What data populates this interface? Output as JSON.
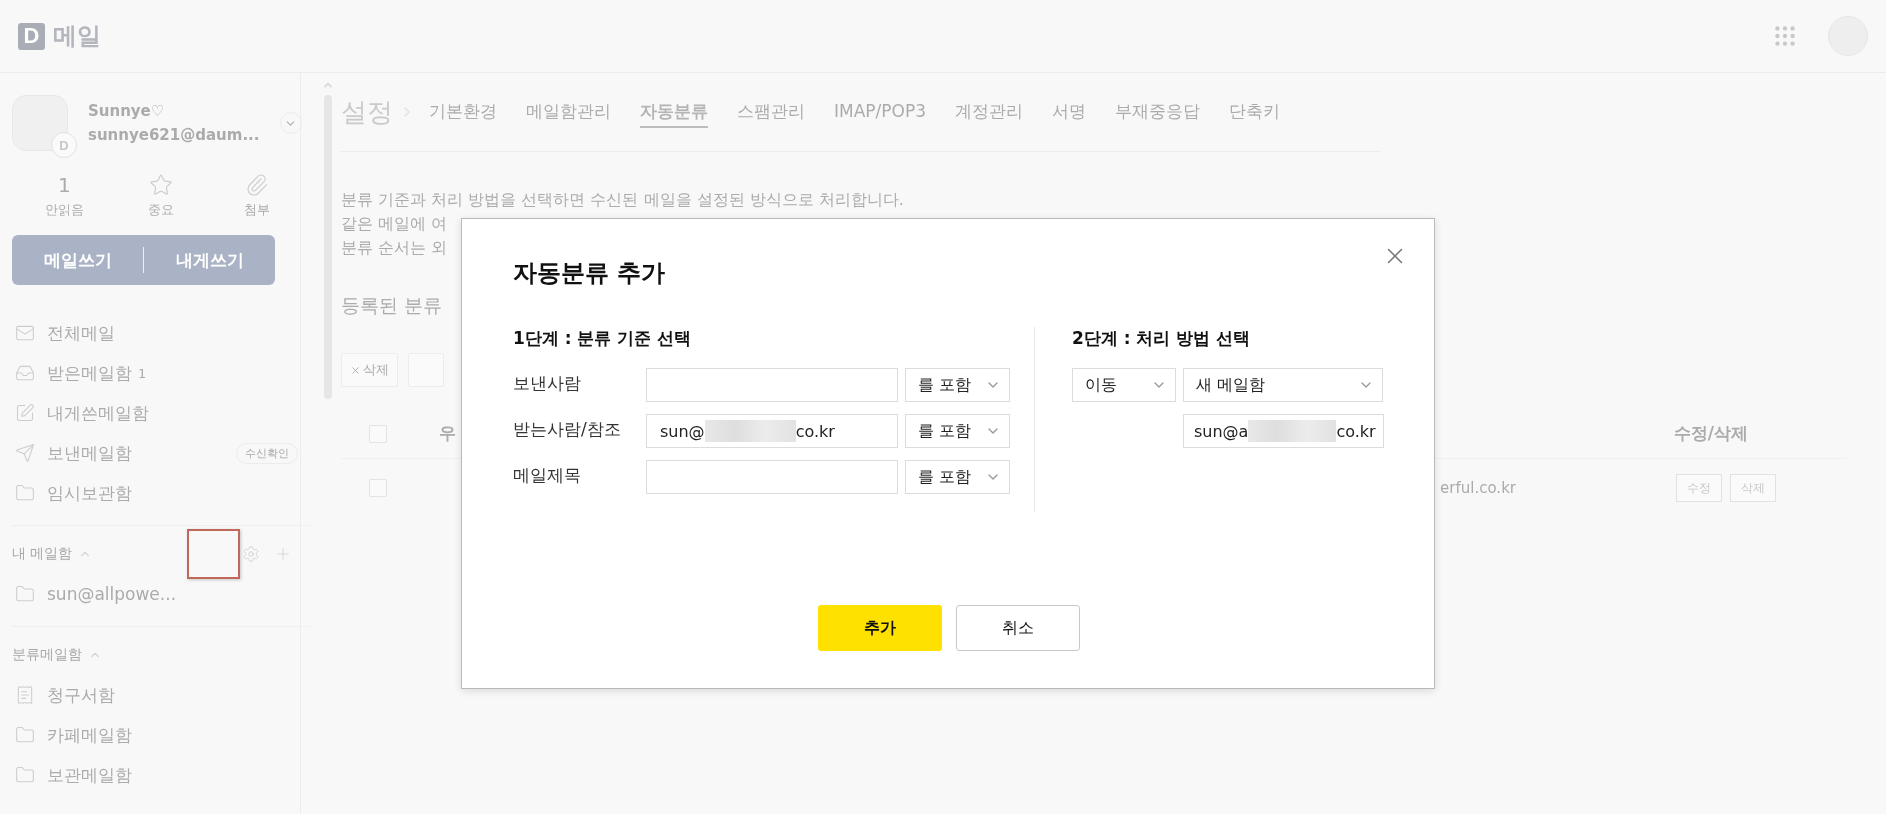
{
  "header": {
    "logo_letter": "D",
    "logo_text": "메일"
  },
  "profile": {
    "badge_letter": "D",
    "name": "Sunnye♡",
    "email": "sunnye621@daum..."
  },
  "stats": [
    {
      "kind": "count",
      "value": "1",
      "label": "안읽음"
    },
    {
      "kind": "star",
      "label": "중요"
    },
    {
      "kind": "clip",
      "label": "첨부"
    }
  ],
  "write_buttons": [
    "메일쓰기",
    "내게쓰기"
  ],
  "folders": [
    {
      "kind": "mail",
      "label": "전체메일"
    },
    {
      "kind": "inbox",
      "label": "받은메일함",
      "count": "1"
    },
    {
      "kind": "edit",
      "label": "내게쓴메일함"
    },
    {
      "kind": "send",
      "label": "보낸메일함",
      "badge": "수신확인"
    },
    {
      "kind": "folder",
      "label": "임시보관함"
    }
  ],
  "my_mailboxes": {
    "title": "내 메일함",
    "expanded": true,
    "highlighted": true,
    "items": [
      {
        "kind": "folder",
        "label": "sun@allpowe..."
      }
    ]
  },
  "category_mailboxes": {
    "title": "분류메일함",
    "expanded": true,
    "items": [
      {
        "kind": "bill",
        "label": "청구서함"
      },
      {
        "kind": "folder",
        "label": "카페메일함"
      },
      {
        "kind": "folder",
        "label": "보관메일함"
      }
    ]
  },
  "settings": {
    "title": "설정",
    "tabs": [
      {
        "label": "기본환경",
        "selected": false
      },
      {
        "label": "메일함관리",
        "selected": false
      },
      {
        "label": "자동분류",
        "selected": true
      },
      {
        "label": "스팸관리",
        "selected": false
      },
      {
        "label": "IMAP/POP3",
        "selected": false
      },
      {
        "label": "계정관리",
        "selected": false
      },
      {
        "label": "서명",
        "selected": false
      },
      {
        "label": "부재중응답",
        "selected": false
      },
      {
        "label": "단축키",
        "selected": false
      }
    ]
  },
  "description": [
    "분류 기준과 처리 방법을 선택하면 수신된 메일을 설정된 방식으로 처리합니다.",
    "같은 메일에 여",
    "분류 순서는 외"
  ],
  "registered_title": "등록된 분류",
  "toolbar": {
    "delete": "삭제"
  },
  "table": {
    "all_checked": false,
    "columns": [
      "우",
      "수정/삭제"
    ],
    "rows": [
      {
        "checked": false,
        "cell": "erful.co.kr",
        "actions": [
          "수정",
          "삭제"
        ]
      }
    ]
  },
  "modal": {
    "title": "자동분류 추가",
    "step1": {
      "title": "1단계 : 분류 기준 선택",
      "rows": [
        {
          "label": "보낸사람",
          "condition": "를 포함"
        },
        {
          "label": "받는사람/참조",
          "value_start": "sun@",
          "value_end": "co.kr",
          "redacted": true,
          "condition": "를 포함"
        },
        {
          "label": "메일제목",
          "condition": "를 포함"
        }
      ]
    },
    "step2": {
      "title": "2단계 : 처리 방법 선택",
      "action": "이동",
      "target": "새 메일함",
      "address": {
        "value_start": "sun@a",
        "value_end": "co.kr",
        "redacted": true
      }
    },
    "buttons": [
      {
        "kind": "primary",
        "label": "추가"
      },
      {
        "kind": "secondary",
        "label": "취소"
      }
    ]
  }
}
